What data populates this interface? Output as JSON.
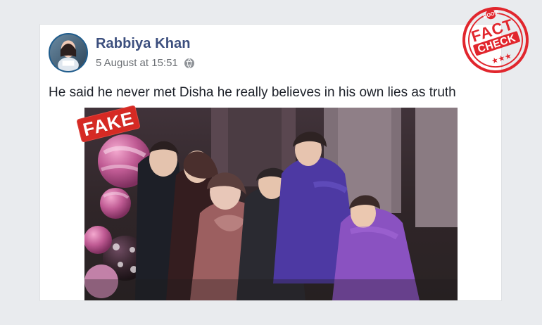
{
  "post": {
    "author": "Rabbiya Khan",
    "timestamp": "5 August at 15:51",
    "privacy_icon": "globe-icon",
    "text": "He said he never met Disha he really believes in his own lies as truth"
  },
  "image": {
    "stamp_text": "FAKE"
  },
  "badge": {
    "brand": "BOOM",
    "line1": "FACT",
    "line2": "CHECK",
    "stars": "★★★",
    "color": "#e1262d"
  },
  "colors": {
    "page_bg": "#e9ebee",
    "author": "#3c4f7e",
    "meta": "#6c7075",
    "text": "#1d2129",
    "stamp": "#d62a24"
  }
}
